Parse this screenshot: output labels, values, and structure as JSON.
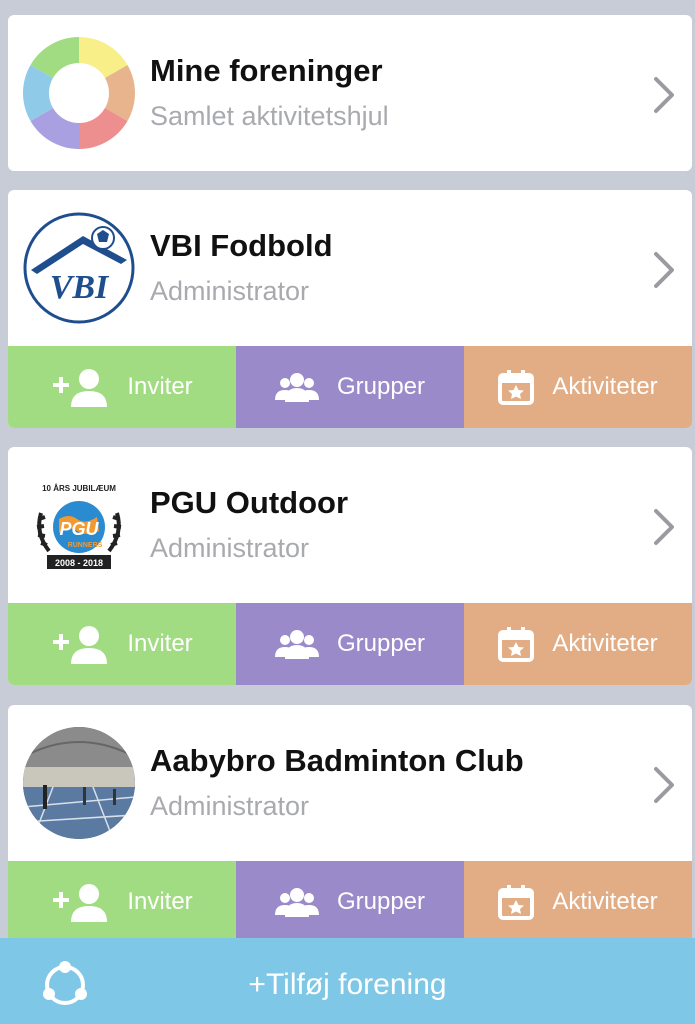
{
  "summary": {
    "title": "Mine foreninger",
    "subtitle": "Samlet aktivitetshjul",
    "wheel_colors": [
      "#f8ef88",
      "#e8b48e",
      "#ec8f8e",
      "#a9a0e2",
      "#8fcae8",
      "#a1dc83"
    ]
  },
  "clubs": [
    {
      "name": "VBI Fodbold",
      "role": "Administrator",
      "logo_text": "VBI"
    },
    {
      "name": "PGU Outdoor",
      "role": "Administrator",
      "logo_text_top": "10 ÅRS JUBILÆUM",
      "logo_text_mid": "PGU",
      "logo_text_sub": "RUNNERS",
      "logo_text_bottom": "2008 - 2018"
    },
    {
      "name": "Aabybro Badminton Club",
      "role": "Administrator"
    }
  ],
  "actions": {
    "invite": "Inviter",
    "groups": "Grupper",
    "activities": "Aktiviteter"
  },
  "colors": {
    "invite": "#a1dc83",
    "groups": "#9a8ac9",
    "activities": "#e2ad85",
    "bottom_bar": "#7fc7e6"
  },
  "bottom": {
    "add_label": "+Tilføj forening"
  }
}
